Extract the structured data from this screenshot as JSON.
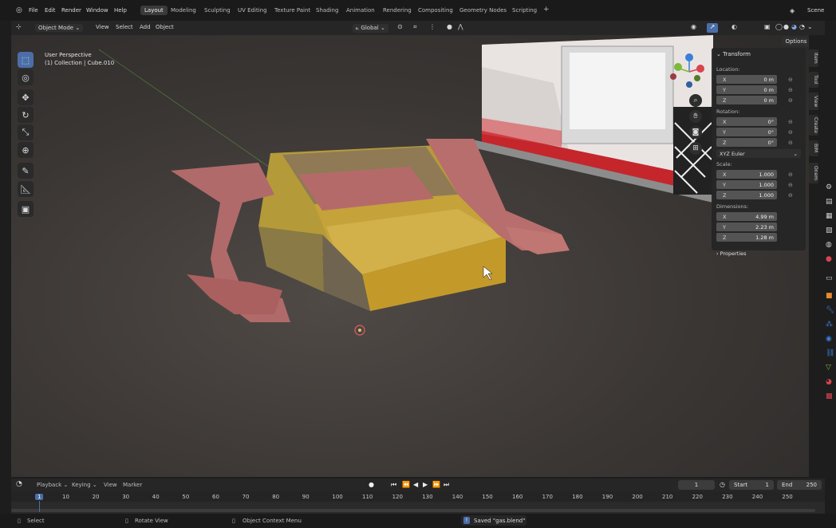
{
  "topbar": {
    "menus": [
      "File",
      "Edit",
      "Render",
      "Window",
      "Help"
    ],
    "workspaces": [
      "Layout",
      "Modeling",
      "Sculpting",
      "UV Editing",
      "Texture Paint",
      "Shading",
      "Animation",
      "Rendering",
      "Compositing",
      "Geometry Nodes",
      "Scripting"
    ],
    "active_workspace": "Layout",
    "add_tab": "+",
    "scene_label": "Scene"
  },
  "header": {
    "mode": "Object Mode",
    "menus": [
      "View",
      "Select",
      "Add",
      "Object"
    ],
    "orientation": "Global",
    "options": "Options"
  },
  "viewport": {
    "label_line1": "User Perspective",
    "label_line2": "(1) Collection | Cube.010"
  },
  "npanel": {
    "title": "Transform",
    "location_label": "Location:",
    "location": [
      {
        "axis": "X",
        "value": "0 m"
      },
      {
        "axis": "Y",
        "value": "0 m"
      },
      {
        "axis": "Z",
        "value": "0 m"
      }
    ],
    "rotation_label": "Rotation:",
    "rotation": [
      {
        "axis": "X",
        "value": "0°"
      },
      {
        "axis": "Y",
        "value": "0°"
      },
      {
        "axis": "Z",
        "value": "0°"
      }
    ],
    "rotation_mode": "XYZ Euler",
    "scale_label": "Scale:",
    "scale": [
      {
        "axis": "X",
        "value": "1.000"
      },
      {
        "axis": "Y",
        "value": "1.000"
      },
      {
        "axis": "Z",
        "value": "1.000"
      }
    ],
    "dimensions_label": "Dimensions:",
    "dimensions": [
      {
        "axis": "X",
        "value": "4.99 m"
      },
      {
        "axis": "Y",
        "value": "2.23 m"
      },
      {
        "axis": "Z",
        "value": "1.28 m"
      }
    ],
    "properties": "Properties"
  },
  "side_tabs": [
    "Item",
    "Tool",
    "View",
    "Create",
    "BIM",
    "Onem"
  ],
  "timeline": {
    "menus": [
      "Playback",
      "Keying",
      "View",
      "Marker"
    ],
    "current_frame": "1",
    "start_label": "Start",
    "start": "1",
    "end_label": "End",
    "end": "250",
    "ticks": [
      "1",
      "10",
      "20",
      "30",
      "40",
      "50",
      "60",
      "70",
      "80",
      "90",
      "100",
      "110",
      "120",
      "130",
      "140",
      "150",
      "160",
      "170",
      "180",
      "190",
      "200",
      "210",
      "220",
      "230",
      "240",
      "250"
    ]
  },
  "status": {
    "select": "Select",
    "rotate": "Rotate View",
    "context": "Object Context Menu",
    "saved": "Saved \"gas.blend\""
  },
  "colors": {
    "accent": "#4b6ea8",
    "axis_x": "#d9434f",
    "axis_y": "#7fb83a",
    "axis_z": "#3a7fd9"
  }
}
